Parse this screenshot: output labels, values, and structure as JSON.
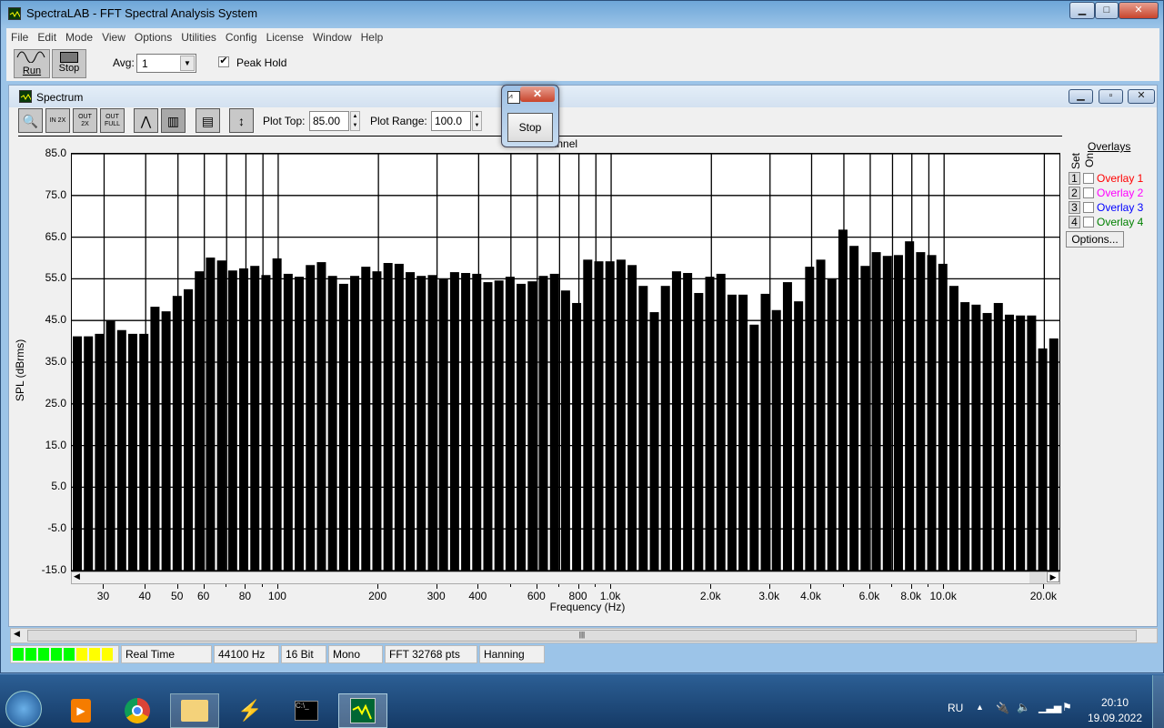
{
  "window": {
    "title": "SpectraLAB - FFT Spectral Analysis System",
    "min": "▁",
    "max": "□",
    "close": "✕"
  },
  "menu": [
    "File",
    "Edit",
    "Mode",
    "View",
    "Options",
    "Utilities",
    "Config",
    "License",
    "Window",
    "Help"
  ],
  "toolbar": {
    "run": "Run",
    "stop": "Stop",
    "avg_label": "Avg:",
    "avg_value": "1",
    "peak_hold": "Peak Hold",
    "peak_hold_checked": true
  },
  "spectrum": {
    "title": "Spectrum",
    "plot_top_label": "Plot Top:",
    "plot_top": "85.00",
    "plot_range_label": "Plot Range:",
    "plot_range": "100.0",
    "tools": [
      "zoom-icon",
      "zoom-in-2x-icon",
      "zoom-out-2x-icon",
      "zoom-out-full-icon",
      "line-plot-icon",
      "bar-plot-icon",
      "table-icon",
      "scale-icon"
    ],
    "zoom_labels": [
      "IN 2X",
      "OUT 2X",
      "OUT FULL"
    ]
  },
  "overlays": {
    "title": "Overlays",
    "set_label": "Set",
    "on_label": "On",
    "options": "Options...",
    "items": [
      {
        "n": "1",
        "label": "Overlay 1",
        "color": "#ff0000"
      },
      {
        "n": "2",
        "label": "Overlay 2",
        "color": "#ff00ff"
      },
      {
        "n": "3",
        "label": "Overlay 3",
        "color": "#0000ff"
      },
      {
        "n": "4",
        "label": "Overlay 4",
        "color": "#008000"
      }
    ]
  },
  "dialog": {
    "stop": "Stop",
    "close": "✕"
  },
  "status": {
    "level_meter": {
      "green_segments": 5,
      "yellow_segments": 3
    },
    "mode": "Real Time",
    "rate": "44100 Hz",
    "bits": "16 Bit",
    "channels": "Mono",
    "fft": "FFT 32768 pts",
    "window": "Hanning"
  },
  "taskbar": {
    "lang": "RU",
    "time": "20:10",
    "date": "19.09.2022"
  },
  "chart_data": {
    "type": "bar",
    "title": "hannel",
    "xlabel": "Frequency (Hz)",
    "ylabel": "SPL (dBrms)",
    "ylim": [
      -15,
      85
    ],
    "xlim": [
      24,
      22200
    ],
    "xscale": "log",
    "grid": true,
    "yticks": [
      "85.0",
      "75.0",
      "65.0",
      "55.0",
      "45.0",
      "35.0",
      "25.0",
      "15.0",
      "5.0",
      "-5.0",
      "-15.0"
    ],
    "xticks": [
      {
        "f": 30,
        "l": "30"
      },
      {
        "f": 40,
        "l": "40"
      },
      {
        "f": 50,
        "l": "50"
      },
      {
        "f": 60,
        "l": "60"
      },
      {
        "f": 70,
        "l": ""
      },
      {
        "f": 80,
        "l": "80"
      },
      {
        "f": 90,
        "l": ""
      },
      {
        "f": 100,
        "l": "100"
      },
      {
        "f": 200,
        "l": "200"
      },
      {
        "f": 300,
        "l": "300"
      },
      {
        "f": 400,
        "l": "400"
      },
      {
        "f": 500,
        "l": ""
      },
      {
        "f": 600,
        "l": "600"
      },
      {
        "f": 700,
        "l": ""
      },
      {
        "f": 800,
        "l": "800"
      },
      {
        "f": 900,
        "l": ""
      },
      {
        "f": 1000,
        "l": "1.0k"
      },
      {
        "f": 2000,
        "l": "2.0k"
      },
      {
        "f": 3000,
        "l": "3.0k"
      },
      {
        "f": 4000,
        "l": "4.0k"
      },
      {
        "f": 5000,
        "l": ""
      },
      {
        "f": 6000,
        "l": "6.0k"
      },
      {
        "f": 7000,
        "l": ""
      },
      {
        "f": 8000,
        "l": "8.0k"
      },
      {
        "f": 9000,
        "l": ""
      },
      {
        "f": 10000,
        "l": "10.0k"
      },
      {
        "f": 20000,
        "l": "20.0k"
      }
    ],
    "values": [
      41.2,
      41.2,
      41.8,
      45.1,
      42.7,
      41.8,
      41.8,
      48.3,
      47.2,
      50.9,
      52.5,
      56.8,
      60.1,
      59.4,
      57.0,
      57.5,
      58.1,
      55.9,
      59.9,
      56.2,
      55.5,
      58.3,
      59.0,
      55.7,
      53.8,
      55.7,
      57.9,
      56.8,
      58.8,
      58.6,
      56.6,
      55.7,
      55.9,
      55.1,
      56.6,
      56.4,
      56.2,
      54.2,
      54.6,
      55.5,
      53.8,
      54.4,
      55.7,
      56.2,
      52.2,
      49.2,
      59.6,
      59.2,
      59.2,
      59.6,
      58.3,
      53.3,
      47.0,
      53.3,
      56.8,
      56.4,
      51.6,
      55.5,
      56.2,
      51.2,
      51.2,
      44.0,
      51.4,
      47.5,
      54.2,
      49.6,
      57.9,
      59.6,
      55.1,
      66.8,
      62.9,
      58.1,
      61.4,
      60.5,
      60.7,
      64.0,
      61.4,
      60.7,
      58.6,
      53.3,
      49.4,
      48.8,
      46.8,
      49.2,
      46.4,
      46.2,
      46.2,
      38.3,
      40.7
    ]
  }
}
